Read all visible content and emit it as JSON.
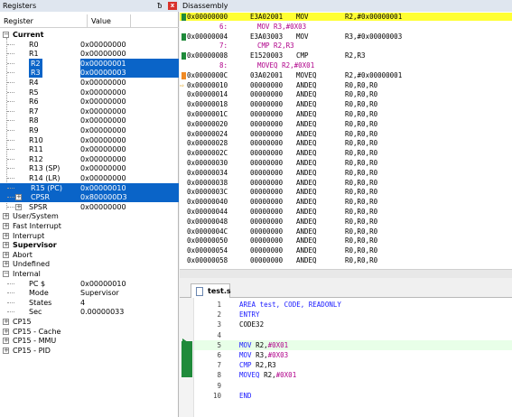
{
  "registers_pane": {
    "title": "Registers",
    "pin_glyph": "ᵬ",
    "close_glyph": "x",
    "col_register": "Register",
    "col_value": "Value",
    "current_label": "Current",
    "rows": [
      {
        "name": "R0",
        "value": "0x00000000"
      },
      {
        "name": "R1",
        "value": "0x00000000"
      },
      {
        "name": "R2",
        "value": "0x00000001"
      },
      {
        "name": "R3",
        "value": "0x00000003"
      },
      {
        "name": "R4",
        "value": "0x00000000"
      },
      {
        "name": "R5",
        "value": "0x00000000"
      },
      {
        "name": "R6",
        "value": "0x00000000"
      },
      {
        "name": "R7",
        "value": "0x00000000"
      },
      {
        "name": "R8",
        "value": "0x00000000"
      },
      {
        "name": "R9",
        "value": "0x00000000"
      },
      {
        "name": "R10",
        "value": "0x00000000"
      },
      {
        "name": "R11",
        "value": "0x00000000"
      },
      {
        "name": "R12",
        "value": "0x00000000"
      },
      {
        "name": "R13 (SP)",
        "value": "0x00000000"
      },
      {
        "name": "R14 (LR)",
        "value": "0x00000000"
      },
      {
        "name": "R15 (PC)",
        "value": "0x00000010"
      },
      {
        "name": "CPSR",
        "value": "0x800000D3"
      },
      {
        "name": "SPSR",
        "value": "0x00000000"
      }
    ],
    "groups": [
      "User/System",
      "Fast Interrupt",
      "Interrupt",
      "Supervisor",
      "Abort",
      "Undefined",
      "Internal"
    ],
    "internal": [
      {
        "name": "PC  $",
        "value": "0x00000010"
      },
      {
        "name": "Mode",
        "value": "Supervisor"
      },
      {
        "name": "States",
        "value": "4"
      },
      {
        "name": "Sec",
        "value": "0.00000033"
      }
    ],
    "cp_groups": [
      "CP15",
      "CP15 - Cache",
      "CP15 - MMU",
      "CP15 - PID"
    ]
  },
  "disassembly_pane": {
    "title": "Disassembly",
    "rows": [
      {
        "kind": "instr",
        "addr": "0x00000000",
        "code": "E3A02001",
        "mnem": "MOV",
        "ops": "R2,#0x00000001",
        "highlight": true,
        "marker": "green"
      },
      {
        "kind": "src",
        "no": "6:",
        "text": "MOV R3,#0X03"
      },
      {
        "kind": "instr",
        "addr": "0x00000004",
        "code": "E3A03003",
        "mnem": "MOV",
        "ops": "R3,#0x00000003",
        "marker": "green"
      },
      {
        "kind": "src",
        "no": "7:",
        "text": "CMP R2,R3"
      },
      {
        "kind": "instr",
        "addr": "0x00000008",
        "code": "E1520003",
        "mnem": "CMP",
        "ops": "R2,R3",
        "marker": "green"
      },
      {
        "kind": "src",
        "no": "8:",
        "text": "MOVEQ R2,#0X01"
      },
      {
        "kind": "instr",
        "addr": "0x0000000C",
        "code": "03A02001",
        "mnem": "MOVEQ",
        "ops": "R2,#0x00000001",
        "marker": "orange"
      },
      {
        "kind": "instr",
        "addr": "0x00000010",
        "code": "00000000",
        "mnem": "ANDEQ",
        "ops": "R0,R0,R0",
        "arrow": true
      },
      {
        "kind": "instr",
        "addr": "0x00000014",
        "code": "00000000",
        "mnem": "ANDEQ",
        "ops": "R0,R0,R0"
      },
      {
        "kind": "instr",
        "addr": "0x00000018",
        "code": "00000000",
        "mnem": "ANDEQ",
        "ops": "R0,R0,R0"
      },
      {
        "kind": "instr",
        "addr": "0x0000001C",
        "code": "00000000",
        "mnem": "ANDEQ",
        "ops": "R0,R0,R0"
      },
      {
        "kind": "instr",
        "addr": "0x00000020",
        "code": "00000000",
        "mnem": "ANDEQ",
        "ops": "R0,R0,R0"
      },
      {
        "kind": "instr",
        "addr": "0x00000024",
        "code": "00000000",
        "mnem": "ANDEQ",
        "ops": "R0,R0,R0"
      },
      {
        "kind": "instr",
        "addr": "0x00000028",
        "code": "00000000",
        "mnem": "ANDEQ",
        "ops": "R0,R0,R0"
      },
      {
        "kind": "instr",
        "addr": "0x0000002C",
        "code": "00000000",
        "mnem": "ANDEQ",
        "ops": "R0,R0,R0"
      },
      {
        "kind": "instr",
        "addr": "0x00000030",
        "code": "00000000",
        "mnem": "ANDEQ",
        "ops": "R0,R0,R0"
      },
      {
        "kind": "instr",
        "addr": "0x00000034",
        "code": "00000000",
        "mnem": "ANDEQ",
        "ops": "R0,R0,R0"
      },
      {
        "kind": "instr",
        "addr": "0x00000038",
        "code": "00000000",
        "mnem": "ANDEQ",
        "ops": "R0,R0,R0"
      },
      {
        "kind": "instr",
        "addr": "0x0000003C",
        "code": "00000000",
        "mnem": "ANDEQ",
        "ops": "R0,R0,R0"
      },
      {
        "kind": "instr",
        "addr": "0x00000040",
        "code": "00000000",
        "mnem": "ANDEQ",
        "ops": "R0,R0,R0"
      },
      {
        "kind": "instr",
        "addr": "0x00000044",
        "code": "00000000",
        "mnem": "ANDEQ",
        "ops": "R0,R0,R0"
      },
      {
        "kind": "instr",
        "addr": "0x00000048",
        "code": "00000000",
        "mnem": "ANDEQ",
        "ops": "R0,R0,R0"
      },
      {
        "kind": "instr",
        "addr": "0x0000004C",
        "code": "00000000",
        "mnem": "ANDEQ",
        "ops": "R0,R0,R0"
      },
      {
        "kind": "instr",
        "addr": "0x00000050",
        "code": "00000000",
        "mnem": "ANDEQ",
        "ops": "R0,R0,R0"
      },
      {
        "kind": "instr",
        "addr": "0x00000054",
        "code": "00000000",
        "mnem": "ANDEQ",
        "ops": "R0,R0,R0"
      },
      {
        "kind": "instr",
        "addr": "0x00000058",
        "code": "00000000",
        "mnem": "ANDEQ",
        "ops": "R0,R0,R0"
      }
    ]
  },
  "editor": {
    "tab_label": "test.s",
    "lines": [
      {
        "no": "1",
        "parts": [
          [
            "blue",
            "AREA test, CODE, READONLY"
          ]
        ]
      },
      {
        "no": "2",
        "parts": [
          [
            "blue",
            "ENTRY"
          ]
        ]
      },
      {
        "no": "3",
        "parts": [
          [
            "black",
            "CODE32"
          ]
        ]
      },
      {
        "no": "4",
        "parts": []
      },
      {
        "no": "5",
        "parts": [
          [
            "blue",
            "MOV "
          ],
          [
            "black",
            "R2,"
          ],
          [
            "pink",
            "#0X01"
          ]
        ],
        "current": true
      },
      {
        "no": "6",
        "parts": [
          [
            "blue",
            "MOV "
          ],
          [
            "black",
            "R3,"
          ],
          [
            "pink",
            "#0X03"
          ]
        ]
      },
      {
        "no": "7",
        "parts": [
          [
            "blue",
            "CMP "
          ],
          [
            "black",
            "R2,R3"
          ]
        ]
      },
      {
        "no": "8",
        "parts": [
          [
            "blue",
            "MOVEQ "
          ],
          [
            "black",
            "R2,"
          ],
          [
            "pink",
            "#0X01"
          ]
        ]
      },
      {
        "no": "9",
        "parts": []
      },
      {
        "no": "10",
        "parts": [
          [
            "blue",
            "END"
          ]
        ]
      }
    ]
  },
  "colors": {
    "selection": "#0a64c8",
    "pc_highlight": "#ffff33",
    "exec_marker": "#1f8a3a",
    "next_marker": "#f08a24",
    "source_text": "#b0008a",
    "keyword": "#1a1aff"
  }
}
